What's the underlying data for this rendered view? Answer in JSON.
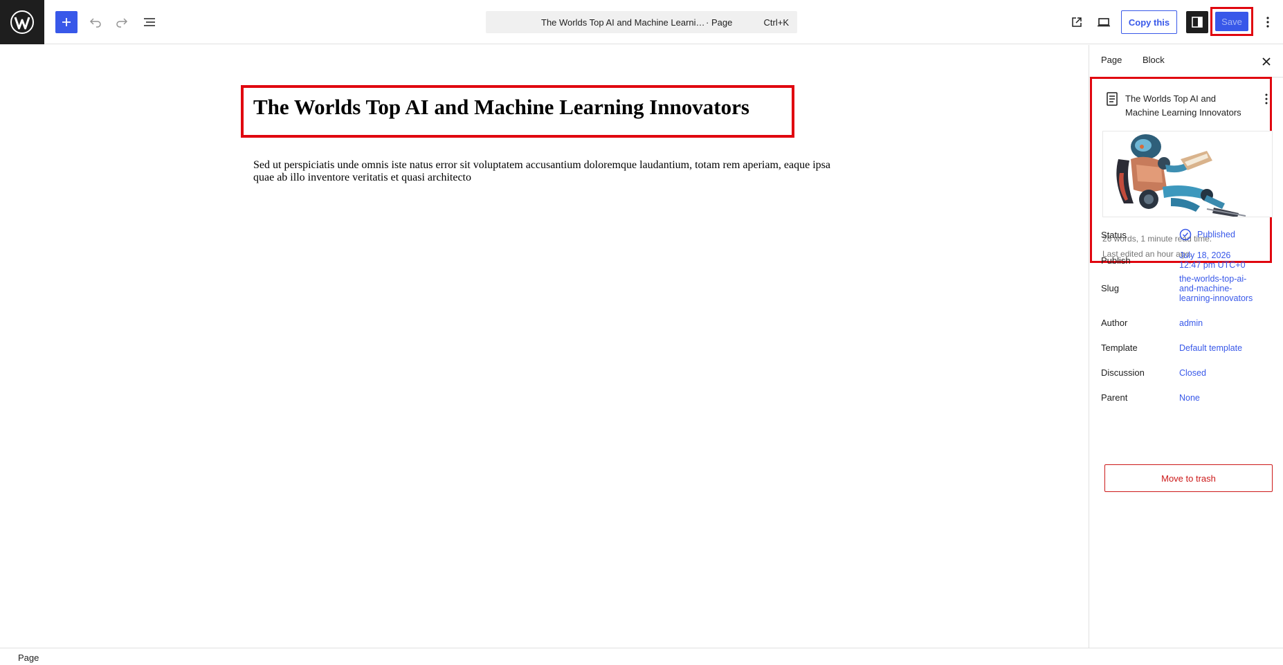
{
  "app": {
    "logo": "wordpress-logo"
  },
  "toolbar": {
    "icons": {
      "add": "plus-icon",
      "undo": "undo-icon",
      "redo": "redo-icon",
      "list_view": "list-view-icon",
      "view": "external-link-icon",
      "preview": "device-preview-icon",
      "settings": "sidebar-toggle-icon",
      "options": "vertical-ellipsis-icon"
    },
    "command_bar": {
      "title": "The Worlds Top AI and Machine Learni…",
      "type": "· Page",
      "shortcut": "Ctrl+K"
    },
    "copy_label": "Copy this",
    "save_label": "Save"
  },
  "editor": {
    "title": "The Worlds Top AI and Machine Learning Innovators",
    "paragraph": "Sed ut perspiciatis unde omnis iste natus error sit voluptatem accusantium doloremque laudantium, totam rem aperiam, eaque ipsa quae ab illo inventore veritatis et quasi architecto"
  },
  "sidebar": {
    "tabs": [
      {
        "label": "Page"
      },
      {
        "label": "Block"
      }
    ],
    "summary": {
      "title": "The Worlds Top AI and Machine Learning Innovators",
      "featured_image": "robot-reading-book-illustration",
      "word_count": "26 words, 1 minute read time.",
      "last_edited": "Last edited an hour ago."
    },
    "fields": [
      {
        "label": "Status",
        "value": "Published"
      },
      {
        "label": "Publish",
        "value_line1": "July 18, 2026",
        "value_line2": "12:47 pm UTC+0"
      },
      {
        "label": "Slug",
        "value_line1": "the-worlds-top-ai-",
        "value_line2": "and-machine-",
        "value_line3": "learning-innovators"
      },
      {
        "label": "Author",
        "value": "admin"
      },
      {
        "label": "Template",
        "value": "Default template"
      },
      {
        "label": "Discussion",
        "value": "Closed"
      },
      {
        "label": "Parent",
        "value": "None"
      }
    ],
    "trash_label": "Move to trash"
  },
  "footer": {
    "breadcrumb": "Page"
  },
  "colors": {
    "accent": "#3858e9",
    "danger": "#cc1818",
    "highlight": "#e0060f",
    "dark": "#1e1e1e"
  }
}
